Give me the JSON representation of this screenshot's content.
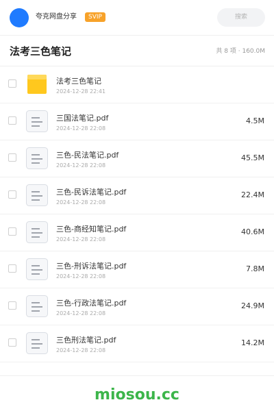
{
  "header": {
    "brand": "夸克网盘分享",
    "badge": "SVIP",
    "search_placeholder": "搜索"
  },
  "folder": {
    "title": "法考三色笔记",
    "summary": "共 8 项 · 160.0M"
  },
  "files": [
    {
      "name": "法考三色笔记",
      "date": "2024-12-28 22:41",
      "size": "",
      "type": "folder-icon"
    },
    {
      "name": "三国法笔记.pdf",
      "date": "2024-12-28 22:08",
      "size": "4.5M",
      "type": "document-icon"
    },
    {
      "name": "三色-民法笔记.pdf",
      "date": "2024-12-28 22:08",
      "size": "45.5M",
      "type": "document-icon"
    },
    {
      "name": "三色-民诉法笔记.pdf",
      "date": "2024-12-28 22:08",
      "size": "22.4M",
      "type": "document-icon"
    },
    {
      "name": "三色-商经知笔记.pdf",
      "date": "2024-12-28 22:08",
      "size": "40.6M",
      "type": "document-icon"
    },
    {
      "name": "三色-刑诉法笔记.pdf",
      "date": "2024-12-28 22:08",
      "size": "7.8M",
      "type": "document-icon"
    },
    {
      "name": "三色-行政法笔记.pdf",
      "date": "2024-12-28 22:08",
      "size": "24.9M",
      "type": "document-icon"
    },
    {
      "name": "三色刑法笔记.pdf",
      "date": "2024-12-28 22:08",
      "size": "14.2M",
      "type": "document-icon"
    }
  ],
  "footer": {
    "watermark": "miosou.cc"
  },
  "colors": {
    "accent": "#1f7bff",
    "badge": "#f7a22a",
    "folder": "#ffc81e",
    "watermark": "#3cb54a"
  }
}
